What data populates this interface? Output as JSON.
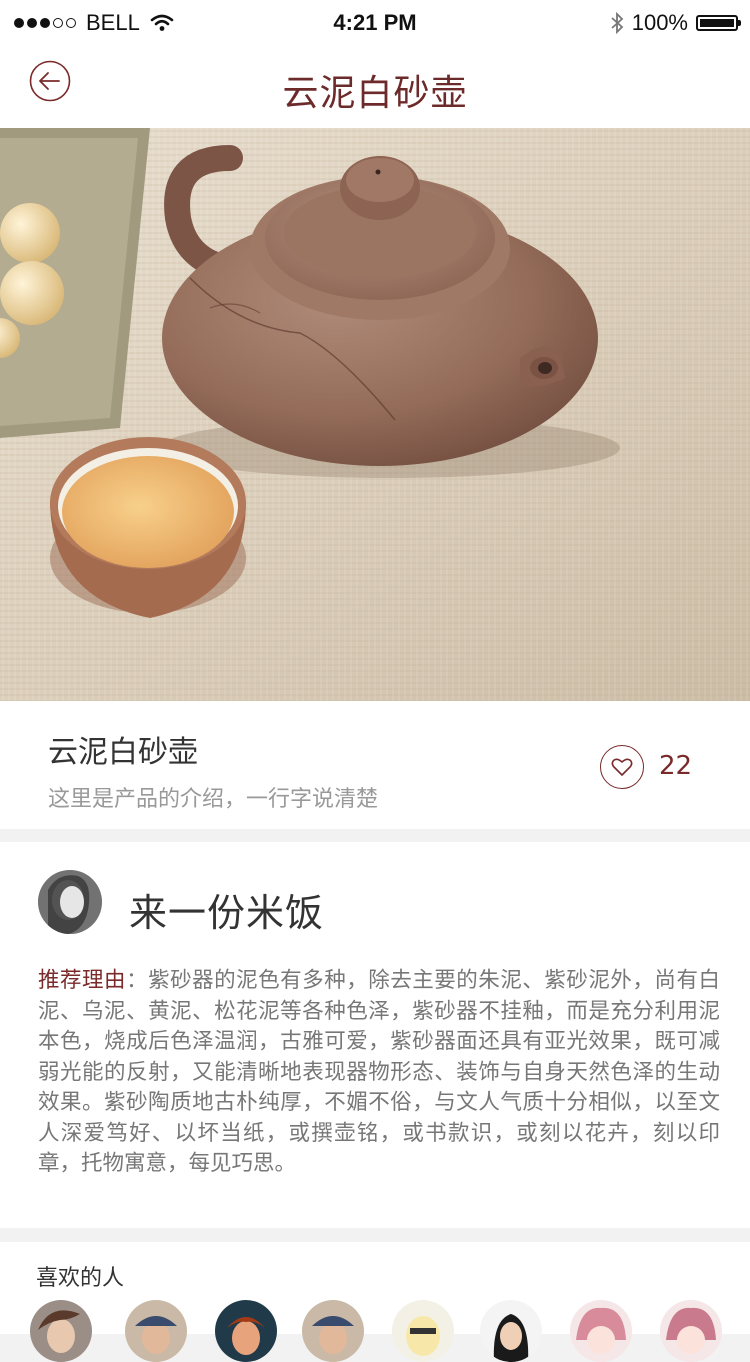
{
  "status_bar": {
    "carrier": "BELL",
    "time": "4:21 PM",
    "battery_text": "100%",
    "battery_level": 1.0,
    "signal_filled": 3,
    "signal_total": 5
  },
  "nav": {
    "title": "云泥白砂壶",
    "back_icon": "back-arrow-icon"
  },
  "product": {
    "title": "云泥白砂壶",
    "description": "这里是产品的介绍，一行字说清楚",
    "like_count": "22",
    "like_icon": "heart-icon"
  },
  "recommendation": {
    "user_name": "来一份米饭",
    "label": "推荐理由",
    "separator": "：",
    "text": "紫砂器的泥色有多种，除去主要的朱泥、紫砂泥外，尚有白泥、乌泥、黄泥、松花泥等各种色泽，紫砂器不挂釉，而是充分利用泥本色，烧成后色泽温润，古雅可爱，紫砂器面还具有亚光效果，既可减弱光能的反射，又能清晰地表现器物形态、装饰与自身天然色泽的生动效果。紫砂陶质地古朴纯厚，不媚不俗，与文人气质十分相似，以至文人深爱笃好、以坏当纸，或撰壶铭，或书款识，或刻以花卉，刻以印章，托物寓意，每见巧思。"
  },
  "likers": {
    "title": "喜欢的人",
    "count": 8
  },
  "colors": {
    "accent": "#7a2a2a",
    "title": "#6d2a2a",
    "text_muted": "#999999"
  }
}
